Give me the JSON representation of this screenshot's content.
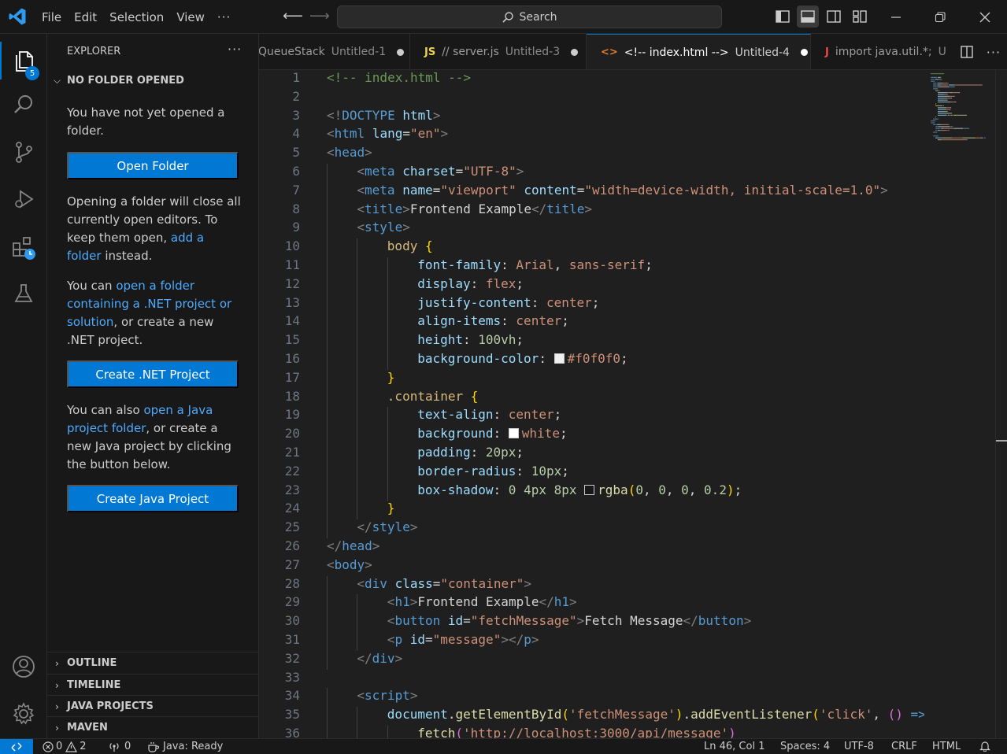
{
  "menu": [
    "File",
    "Edit",
    "Selection",
    "View"
  ],
  "titlebar": {
    "search_label": "Search"
  },
  "activity": {
    "explorer_badge": "5"
  },
  "sidebar": {
    "header": "EXPLORER",
    "section": "NO FOLDER OPENED",
    "p1": "You have not yet opened a folder.",
    "open_folder_button": "Open Folder",
    "p2_a": "Opening a folder will close all currently open editors. To keep them open, ",
    "p2_link": "add a folder",
    "p2_b": " instead.",
    "p3_a": "You can ",
    "p3_link": "open a folder containing a .NET project or solution",
    "p3_b": ", or create a new .NET project.",
    "create_net_button": "Create .NET Project",
    "p4_a": "You can also ",
    "p4_link": "open a Java project folder",
    "p4_b": ", or create a new Java project by clicking the button below.",
    "create_java_button": "Create Java Project",
    "bottom_sections": [
      "OUTLINE",
      "TIMELINE",
      "JAVA PROJECTS",
      "MAVEN"
    ]
  },
  "tabs": [
    {
      "label": "QueueStack",
      "sub": "Untitled-1",
      "icon": ""
    },
    {
      "label": "// server.js",
      "sub": "Untitled-3",
      "icon": "JS"
    },
    {
      "label": "<!-- index.html -->",
      "sub": "Untitled-4",
      "icon": "<>"
    },
    {
      "label": "import java.util.*;",
      "sub": "U",
      "icon": "J"
    }
  ],
  "editor": {
    "lines": [
      {
        "n": 1,
        "indent": 0,
        "tokens": [
          [
            "t-comment",
            "<!-- index.html -->"
          ]
        ]
      },
      {
        "n": 2,
        "indent": 0,
        "tokens": []
      },
      {
        "n": 3,
        "indent": 0,
        "tokens": [
          [
            "t-tag",
            "<!"
          ],
          [
            "t-name",
            "DOCTYPE"
          ],
          [
            "t-text",
            " "
          ],
          [
            "t-attr",
            "html"
          ],
          [
            "t-tag",
            ">"
          ]
        ]
      },
      {
        "n": 4,
        "indent": 0,
        "tokens": [
          [
            "t-tag",
            "<"
          ],
          [
            "t-name",
            "html"
          ],
          [
            "t-text",
            " "
          ],
          [
            "t-attr",
            "lang"
          ],
          [
            "t-text",
            "="
          ],
          [
            "t-str",
            "\"en\""
          ],
          [
            "t-tag",
            ">"
          ]
        ]
      },
      {
        "n": 5,
        "indent": 0,
        "tokens": [
          [
            "t-tag",
            "<"
          ],
          [
            "t-name",
            "head"
          ],
          [
            "t-tag",
            ">"
          ]
        ]
      },
      {
        "n": 6,
        "indent": 1,
        "tokens": [
          [
            "t-tag",
            "<"
          ],
          [
            "t-name",
            "meta"
          ],
          [
            "t-text",
            " "
          ],
          [
            "t-attr",
            "charset"
          ],
          [
            "t-text",
            "="
          ],
          [
            "t-str",
            "\"UTF-8\""
          ],
          [
            "t-tag",
            ">"
          ]
        ]
      },
      {
        "n": 7,
        "indent": 1,
        "tokens": [
          [
            "t-tag",
            "<"
          ],
          [
            "t-name",
            "meta"
          ],
          [
            "t-text",
            " "
          ],
          [
            "t-attr",
            "name"
          ],
          [
            "t-text",
            "="
          ],
          [
            "t-str",
            "\"viewport\""
          ],
          [
            "t-text",
            " "
          ],
          [
            "t-attr",
            "content"
          ],
          [
            "t-text",
            "="
          ],
          [
            "t-str",
            "\"width=device-width, initial-scale=1.0\""
          ],
          [
            "t-tag",
            ">"
          ]
        ]
      },
      {
        "n": 8,
        "indent": 1,
        "tokens": [
          [
            "t-tag",
            "<"
          ],
          [
            "t-name",
            "title"
          ],
          [
            "t-tag",
            ">"
          ],
          [
            "t-text",
            "Frontend Example"
          ],
          [
            "t-tag",
            "</"
          ],
          [
            "t-name",
            "title"
          ],
          [
            "t-tag",
            ">"
          ]
        ]
      },
      {
        "n": 9,
        "indent": 1,
        "tokens": [
          [
            "t-tag",
            "<"
          ],
          [
            "t-name",
            "style"
          ],
          [
            "t-tag",
            ">"
          ]
        ]
      },
      {
        "n": 10,
        "indent": 2,
        "tokens": [
          [
            "t-sel",
            "body"
          ],
          [
            "t-text",
            " "
          ],
          [
            "t-brace",
            "{"
          ]
        ]
      },
      {
        "n": 11,
        "indent": 3,
        "tokens": [
          [
            "t-prop",
            "font-family"
          ],
          [
            "t-punct",
            ": "
          ],
          [
            "t-val",
            "Arial"
          ],
          [
            "t-punct",
            ", "
          ],
          [
            "t-val",
            "sans-serif"
          ],
          [
            "t-punct",
            ";"
          ]
        ]
      },
      {
        "n": 12,
        "indent": 3,
        "tokens": [
          [
            "t-prop",
            "display"
          ],
          [
            "t-punct",
            ": "
          ],
          [
            "t-val",
            "flex"
          ],
          [
            "t-punct",
            ";"
          ]
        ]
      },
      {
        "n": 13,
        "indent": 3,
        "tokens": [
          [
            "t-prop",
            "justify-content"
          ],
          [
            "t-punct",
            ": "
          ],
          [
            "t-val",
            "center"
          ],
          [
            "t-punct",
            ";"
          ]
        ]
      },
      {
        "n": 14,
        "indent": 3,
        "tokens": [
          [
            "t-prop",
            "align-items"
          ],
          [
            "t-punct",
            ": "
          ],
          [
            "t-val",
            "center"
          ],
          [
            "t-punct",
            ";"
          ]
        ]
      },
      {
        "n": 15,
        "indent": 3,
        "tokens": [
          [
            "t-prop",
            "height"
          ],
          [
            "t-punct",
            ": "
          ],
          [
            "t-num",
            "100vh"
          ],
          [
            "t-punct",
            ";"
          ]
        ]
      },
      {
        "n": 16,
        "indent": 3,
        "tokens": [
          [
            "t-prop",
            "background-color"
          ],
          [
            "t-punct",
            ": "
          ],
          [
            "swatch",
            "#f0f0f0"
          ],
          [
            "t-val",
            "#f0f0f0"
          ],
          [
            "t-punct",
            ";"
          ]
        ]
      },
      {
        "n": 17,
        "indent": 2,
        "tokens": [
          [
            "t-brace",
            "}"
          ]
        ]
      },
      {
        "n": 18,
        "indent": 2,
        "tokens": [
          [
            "t-sel",
            ".container"
          ],
          [
            "t-text",
            " "
          ],
          [
            "t-brace",
            "{"
          ]
        ]
      },
      {
        "n": 19,
        "indent": 3,
        "tokens": [
          [
            "t-prop",
            "text-align"
          ],
          [
            "t-punct",
            ": "
          ],
          [
            "t-val",
            "center"
          ],
          [
            "t-punct",
            ";"
          ]
        ]
      },
      {
        "n": 20,
        "indent": 3,
        "tokens": [
          [
            "t-prop",
            "background"
          ],
          [
            "t-punct",
            ": "
          ],
          [
            "swatch",
            "#ffffff"
          ],
          [
            "t-val",
            "white"
          ],
          [
            "t-punct",
            ";"
          ]
        ]
      },
      {
        "n": 21,
        "indent": 3,
        "tokens": [
          [
            "t-prop",
            "padding"
          ],
          [
            "t-punct",
            ": "
          ],
          [
            "t-num",
            "20px"
          ],
          [
            "t-punct",
            ";"
          ]
        ]
      },
      {
        "n": 22,
        "indent": 3,
        "tokens": [
          [
            "t-prop",
            "border-radius"
          ],
          [
            "t-punct",
            ": "
          ],
          [
            "t-num",
            "10px"
          ],
          [
            "t-punct",
            ";"
          ]
        ]
      },
      {
        "n": 23,
        "indent": 3,
        "tokens": [
          [
            "t-prop",
            "box-shadow"
          ],
          [
            "t-punct",
            ": "
          ],
          [
            "t-num",
            "0"
          ],
          [
            "t-text",
            " "
          ],
          [
            "t-num",
            "4px"
          ],
          [
            "t-text",
            " "
          ],
          [
            "t-num",
            "8px"
          ],
          [
            "t-text",
            " "
          ],
          [
            "swatch",
            "rgba(0,0,0,0.2)"
          ],
          [
            "t-fn",
            "rgba"
          ],
          [
            "t-brace",
            "("
          ],
          [
            "t-num",
            "0"
          ],
          [
            "t-punct",
            ", "
          ],
          [
            "t-num",
            "0"
          ],
          [
            "t-punct",
            ", "
          ],
          [
            "t-num",
            "0"
          ],
          [
            "t-punct",
            ", "
          ],
          [
            "t-num",
            "0.2"
          ],
          [
            "t-brace",
            ")"
          ],
          [
            "t-punct",
            ";"
          ]
        ]
      },
      {
        "n": 24,
        "indent": 2,
        "tokens": [
          [
            "t-brace",
            "}"
          ]
        ]
      },
      {
        "n": 25,
        "indent": 1,
        "tokens": [
          [
            "t-tag",
            "</"
          ],
          [
            "t-name",
            "style"
          ],
          [
            "t-tag",
            ">"
          ]
        ]
      },
      {
        "n": 26,
        "indent": 0,
        "tokens": [
          [
            "t-tag",
            "</"
          ],
          [
            "t-name",
            "head"
          ],
          [
            "t-tag",
            ">"
          ]
        ]
      },
      {
        "n": 27,
        "indent": 0,
        "tokens": [
          [
            "t-tag",
            "<"
          ],
          [
            "t-name",
            "body"
          ],
          [
            "t-tag",
            ">"
          ]
        ]
      },
      {
        "n": 28,
        "indent": 1,
        "tokens": [
          [
            "t-tag",
            "<"
          ],
          [
            "t-name",
            "div"
          ],
          [
            "t-text",
            " "
          ],
          [
            "t-attr",
            "class"
          ],
          [
            "t-text",
            "="
          ],
          [
            "t-str",
            "\"container\""
          ],
          [
            "t-tag",
            ">"
          ]
        ]
      },
      {
        "n": 29,
        "indent": 2,
        "tokens": [
          [
            "t-tag",
            "<"
          ],
          [
            "t-name",
            "h1"
          ],
          [
            "t-tag",
            ">"
          ],
          [
            "t-text",
            "Frontend Example"
          ],
          [
            "t-tag",
            "</"
          ],
          [
            "t-name",
            "h1"
          ],
          [
            "t-tag",
            ">"
          ]
        ]
      },
      {
        "n": 30,
        "indent": 2,
        "tokens": [
          [
            "t-tag",
            "<"
          ],
          [
            "t-name",
            "button"
          ],
          [
            "t-text",
            " "
          ],
          [
            "t-attr",
            "id"
          ],
          [
            "t-text",
            "="
          ],
          [
            "t-str",
            "\"fetchMessage\""
          ],
          [
            "t-tag",
            ">"
          ],
          [
            "t-text",
            "Fetch Message"
          ],
          [
            "t-tag",
            "</"
          ],
          [
            "t-name",
            "button"
          ],
          [
            "t-tag",
            ">"
          ]
        ]
      },
      {
        "n": 31,
        "indent": 2,
        "tokens": [
          [
            "t-tag",
            "<"
          ],
          [
            "t-name",
            "p"
          ],
          [
            "t-text",
            " "
          ],
          [
            "t-attr",
            "id"
          ],
          [
            "t-text",
            "="
          ],
          [
            "t-str",
            "\"message\""
          ],
          [
            "t-tag",
            "></"
          ],
          [
            "t-name",
            "p"
          ],
          [
            "t-tag",
            ">"
          ]
        ]
      },
      {
        "n": 32,
        "indent": 1,
        "tokens": [
          [
            "t-tag",
            "</"
          ],
          [
            "t-name",
            "div"
          ],
          [
            "t-tag",
            ">"
          ]
        ]
      },
      {
        "n": 33,
        "indent": 0,
        "tokens": []
      },
      {
        "n": 34,
        "indent": 1,
        "tokens": [
          [
            "t-tag",
            "<"
          ],
          [
            "t-name",
            "script"
          ],
          [
            "t-tag",
            ">"
          ]
        ]
      },
      {
        "n": 35,
        "indent": 2,
        "tokens": [
          [
            "t-var",
            "document"
          ],
          [
            "t-punct",
            "."
          ],
          [
            "t-fn",
            "getElementById"
          ],
          [
            "t-brace",
            "("
          ],
          [
            "t-str",
            "'fetchMessage'"
          ],
          [
            "t-brace",
            ")"
          ],
          [
            "t-punct",
            "."
          ],
          [
            "t-fn",
            "addEventListener"
          ],
          [
            "t-brace",
            "("
          ],
          [
            "t-str",
            "'click'"
          ],
          [
            "t-punct",
            ", "
          ],
          [
            "t-paren",
            "()"
          ],
          [
            "t-text",
            " "
          ],
          [
            "t-name",
            "=>"
          ]
        ]
      },
      {
        "n": 36,
        "indent": 3,
        "tokens": [
          [
            "t-fn",
            "fetch"
          ],
          [
            "t-paren",
            "("
          ],
          [
            "t-str",
            "'http://localhost:3000/api/message'"
          ],
          [
            "t-paren",
            ")"
          ]
        ]
      }
    ]
  },
  "statusbar": {
    "errors": "0",
    "warnings": "2",
    "ports": "0",
    "java_status": "Java: Ready",
    "position": "Ln 46, Col 1",
    "spaces": "Spaces: 4",
    "encoding": "UTF-8",
    "eol": "CRLF",
    "language": "HTML"
  },
  "colors": {
    "accent": "#0078d4",
    "link": "#4daafc",
    "background": "#1f1f1f",
    "chrome": "#181818"
  }
}
